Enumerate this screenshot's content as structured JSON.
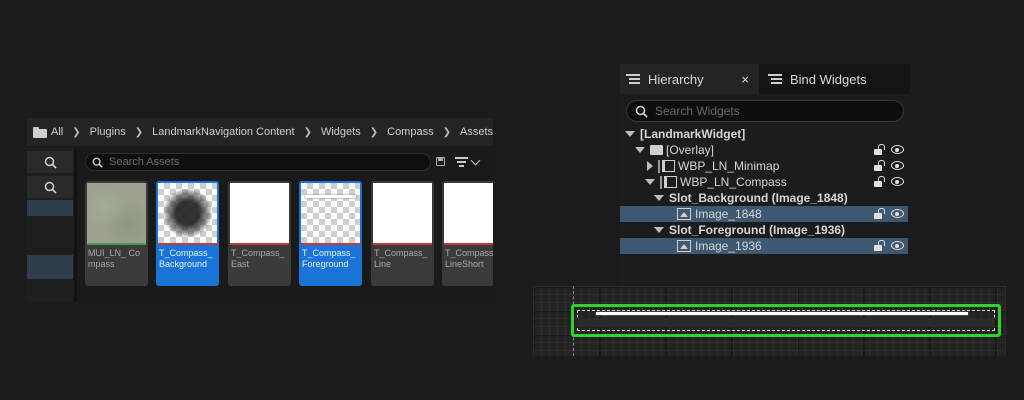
{
  "content_browser": {
    "breadcrumb": [
      "All",
      "Plugins",
      "LandmarkNavigation Content",
      "Widgets",
      "Compass",
      "Assets"
    ],
    "search_placeholder": "Search Assets",
    "assets": [
      {
        "name": "MUI_LN_ Compass",
        "thumbnail": "noise-texture",
        "bar_color": "#3ea23e",
        "selected": false
      },
      {
        "name": "T_Compass_ Background",
        "thumbnail": "dark-blob-on-checker",
        "bar_color": "#c43a3a",
        "selected": true
      },
      {
        "name": "T_Compass_ East",
        "thumbnail": "white",
        "bar_color": "#c43a3a",
        "selected": false
      },
      {
        "name": "T_Compass_ Foreground",
        "thumbnail": "white-line-on-checker",
        "bar_color": "#c43a3a",
        "selected": true
      },
      {
        "name": "T_Compass_ Line",
        "thumbnail": "white",
        "bar_color": "#c43a3a",
        "selected": false
      },
      {
        "name": "T_Compass_ LineShort",
        "thumbnail": "white",
        "bar_color": "#c43a3a",
        "selected": false
      }
    ]
  },
  "hierarchy": {
    "tabs": [
      "Hierarchy",
      "Bind Widgets"
    ],
    "close_glyph": "×",
    "search_placeholder": "Search Widgets",
    "tree": [
      {
        "label": "[LandmarkWidget]",
        "bold": true,
        "icon": "none",
        "expander": "down",
        "selected": false
      },
      {
        "label": "[Overlay]",
        "bold": false,
        "icon": "overlay-icon",
        "expander": "down",
        "selected": false
      },
      {
        "label": "WBP_LN_Minimap",
        "bold": false,
        "icon": "widget-blueprint-icon",
        "expander": "right",
        "selected": false
      },
      {
        "label": "WBP_LN_Compass",
        "bold": false,
        "icon": "widget-blueprint-icon",
        "expander": "down",
        "selected": false
      },
      {
        "label": "Slot_Background (Image_1848)",
        "bold": true,
        "icon": "none",
        "expander": "down",
        "selected": false
      },
      {
        "label": "Image_1848",
        "bold": false,
        "icon": "image-icon",
        "expander": "none",
        "selected": true
      },
      {
        "label": "Slot_Foreground (Image_1936)",
        "bold": true,
        "icon": "none",
        "expander": "down",
        "selected": false
      },
      {
        "label": "Image_1936",
        "bold": false,
        "icon": "image-icon",
        "expander": "none",
        "selected": true
      }
    ]
  },
  "designer": {
    "selection_color": "#2fd12f"
  }
}
